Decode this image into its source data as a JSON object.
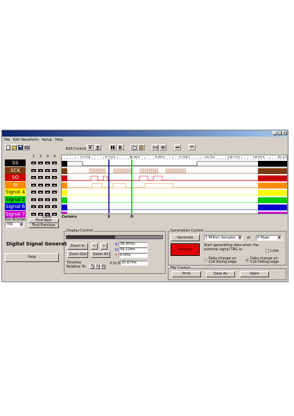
{
  "window": {
    "title_buttons": [
      "_",
      "□",
      "×"
    ]
  },
  "menu": [
    "File",
    "Edit Waveform",
    "Setup",
    "Help"
  ],
  "toolbar": {
    "edit_control_label": "Edit Control",
    "icons": [
      "new-file-icon",
      "open-folder-icon",
      "save-icon",
      "print-icon",
      "move-up-icon",
      "move-down-icon",
      "bar-select-icon",
      "bar-r-icon",
      "copy-icon",
      "paste-icon",
      "expand-icon",
      "compress-icon",
      "line-icon",
      "undo-icon"
    ]
  },
  "columns": [
    "1",
    "2",
    "3",
    "4"
  ],
  "signals": [
    {
      "name": "SS",
      "bg": "#000000",
      "fg": "#ffffff"
    },
    {
      "name": "SCK",
      "bg": "#7b3a10",
      "fg": "#ffffff"
    },
    {
      "name": "SO",
      "bg": "#cc0000",
      "fg": "#ffffff"
    },
    {
      "name": "SI",
      "bg": "#ff8c00",
      "fg": "#ffffff"
    },
    {
      "name": "Signal 4",
      "bg": "#ffff00",
      "fg": "#000000"
    },
    {
      "name": "Signal 5",
      "bg": "#00cc00",
      "fg": "#000000"
    },
    {
      "name": "Signal 6",
      "bg": "#0000cc",
      "fg": "#ffffff"
    },
    {
      "name": "Signal 7",
      "bg": "#cc00cc",
      "fg": "#ffffff"
    }
  ],
  "time_ticks": [
    "14.74ms",
    "35.41ms",
    "56.08ms",
    "76.76ms",
    "97.43ms",
    "118.1ms",
    "138.77ms",
    "159.44ms",
    "180.12ms"
  ],
  "cursors": {
    "label": "Cursors",
    "x_label": "X",
    "o_label": "O"
  },
  "left_panel": {
    "clear_label": "Clear",
    "pod_number_label": "Pod Number",
    "pod_value": "706",
    "find_next_label": "Find Next",
    "find_previous_label": "Find Previous",
    "app_title": "Digital Signal Generator",
    "help_label": "Help"
  },
  "display_control": {
    "title": "Display Control",
    "zoom_in_label": "Zoom In",
    "zoom_out_label": "Zoom Out",
    "zoom_all_label": "Zoom All",
    "prev_label": "<",
    "next_label": ">",
    "x_field_label": "X",
    "x_value": "38.45ms",
    "o_field_label": "O",
    "o_value": "59.12ms",
    "t_field_label": "T",
    "t_value": "0.0ms",
    "timeline_label": "Timeline",
    "relative_to_label": "Relative To:",
    "t_btn": "T",
    "x_btn": "X",
    "o_btn": "O",
    "x_to_o_label": "X to O",
    "x_to_o_value": "20.67ms"
  },
  "generation_control": {
    "title": "Generation Control",
    "generate_label": "Generate",
    "samples_value": "1 Million Samples",
    "at_label": "at",
    "rate_value": "6 Msps",
    "status_label": "Stopped",
    "status_color": "#e00000",
    "description": "Start generating data when the external signal TRG is:",
    "loop_label": "Loop",
    "rising_label": "Data change on CLK Rising edge",
    "falling_label": "Data change on CLK Falling edge"
  },
  "file_control": {
    "title": "File Control",
    "print_label": "Print",
    "save_as_label": "Save As",
    "open_label": "Open"
  }
}
